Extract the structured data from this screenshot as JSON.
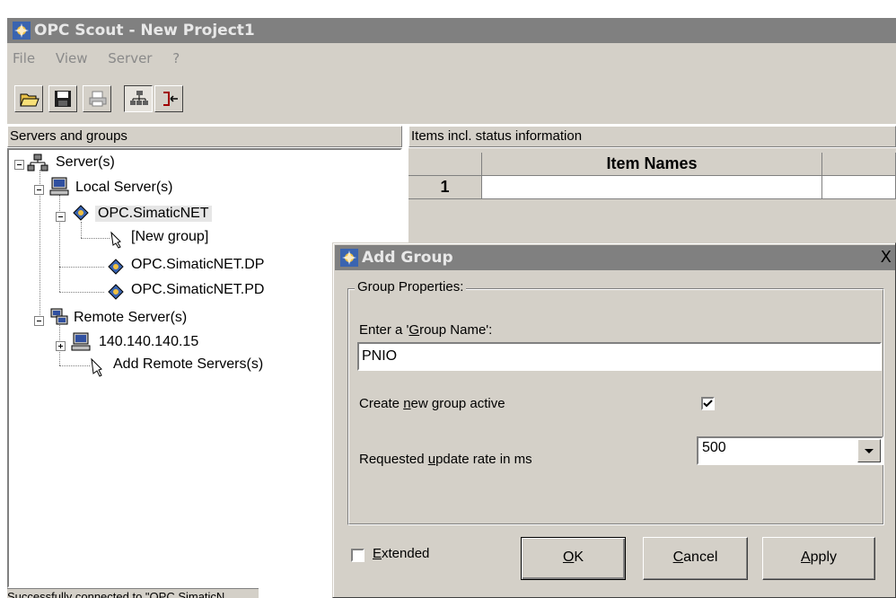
{
  "window": {
    "title": "OPC Scout - New Project1"
  },
  "menu": [
    "File",
    "View",
    "Server",
    "?"
  ],
  "toolbar": {
    "icons": [
      "open-folder-icon",
      "save-disk-icon",
      "print-icon",
      "tree-view-icon",
      "connect-icon"
    ]
  },
  "left_panel": {
    "header": "Servers and groups",
    "tree": [
      {
        "label": "Server(s)",
        "icon": "servers-icon"
      },
      {
        "label": "Local Server(s)",
        "icon": "computer-icon"
      },
      {
        "label": "OPC.SimaticNET",
        "icon": "opc-server-icon"
      },
      {
        "label": "[New group]",
        "icon": "pointer-icon"
      },
      {
        "label": "OPC.SimaticNET.DP",
        "icon": "opc-server-icon"
      },
      {
        "label": "OPC.SimaticNET.PD",
        "icon": "opc-server-icon"
      },
      {
        "label": "Remote Server(s)",
        "icon": "network-icon"
      },
      {
        "label": "140.140.140.15",
        "icon": "computer-icon"
      },
      {
        "label": "Add Remote Servers(s)",
        "icon": "pointer-icon"
      }
    ]
  },
  "status_bar": {
    "text": "Successfully connected to \"OPC.SimaticN"
  },
  "right_panel": {
    "header": "Items incl. status information",
    "grid": {
      "column_header": "Item Names",
      "row_number": "1"
    }
  },
  "dialog": {
    "title": "Add Group",
    "close": "X",
    "group_label": "Group Properties:",
    "name_label": {
      "pre": "Enter a '",
      "u": "G",
      "post": "roup Name':"
    },
    "name_value": "PNIO",
    "active_label": {
      "pre": "Create ",
      "u": "n",
      "post": "ew group active"
    },
    "active_checked": true,
    "rate_label": {
      "pre": "Requested ",
      "u": "u",
      "post": "pdate rate in ms"
    },
    "rate_value": "500",
    "extended_label": {
      "pre": "",
      "u": "E",
      "post": "xtended"
    },
    "extended_checked": false,
    "buttons": {
      "ok": {
        "pre": "",
        "u": "O",
        "post": "K"
      },
      "cancel": {
        "pre": "",
        "u": "C",
        "post": "ancel"
      },
      "apply": {
        "pre": "",
        "u": "A",
        "post": "pply"
      }
    }
  }
}
